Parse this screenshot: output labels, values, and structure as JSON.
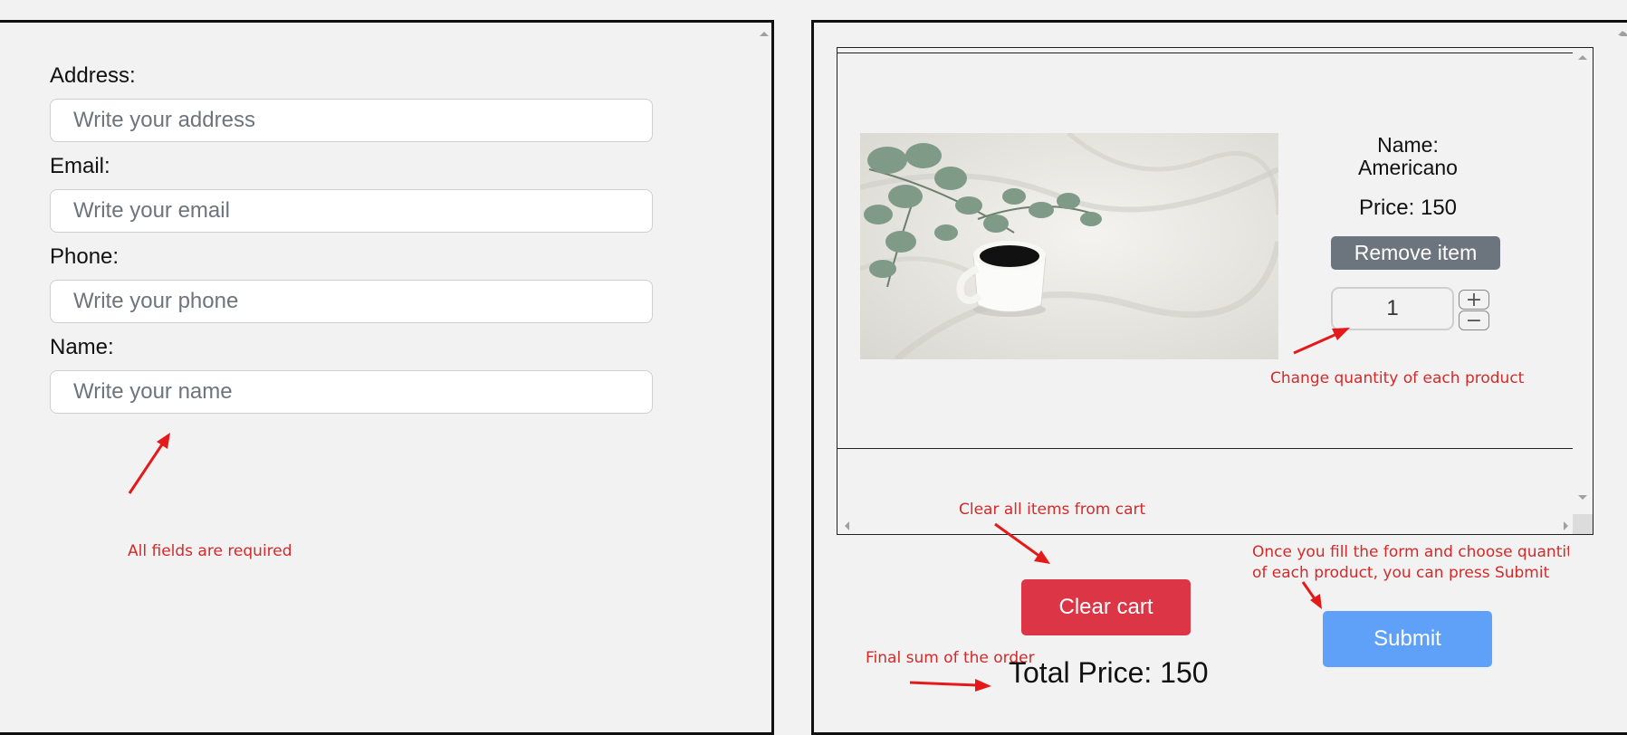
{
  "form": {
    "fields": [
      {
        "label": "Address:",
        "placeholder": "Write your address"
      },
      {
        "label": "Email:",
        "placeholder": "Write your email"
      },
      {
        "label": "Phone:",
        "placeholder": "Write your phone"
      },
      {
        "label": "Name:",
        "placeholder": "Write your name"
      }
    ],
    "annotation": "All fields are required"
  },
  "cart": {
    "item": {
      "name_label": "Name:",
      "name": "Americano",
      "price": "Price: 150",
      "remove_label": "Remove item",
      "quantity": "1",
      "increment_symbol": "+",
      "decrement_symbol": "−"
    },
    "clear_label": "Clear cart",
    "submit_label": "Submit",
    "total": "Total Price: 150"
  },
  "annotations": {
    "quantity": "Change quantity of each product",
    "clear": "Clear all items from cart",
    "submit_line1": "Once you fill the form and choose quantity",
    "submit_line2": "of each product, you can press Submit",
    "total": "Final sum of the order"
  },
  "colors": {
    "annotation": "#d42a2a",
    "remove_button": "#6c757d",
    "clear_button": "#dc3545",
    "submit_button": "#5fa0f8"
  }
}
